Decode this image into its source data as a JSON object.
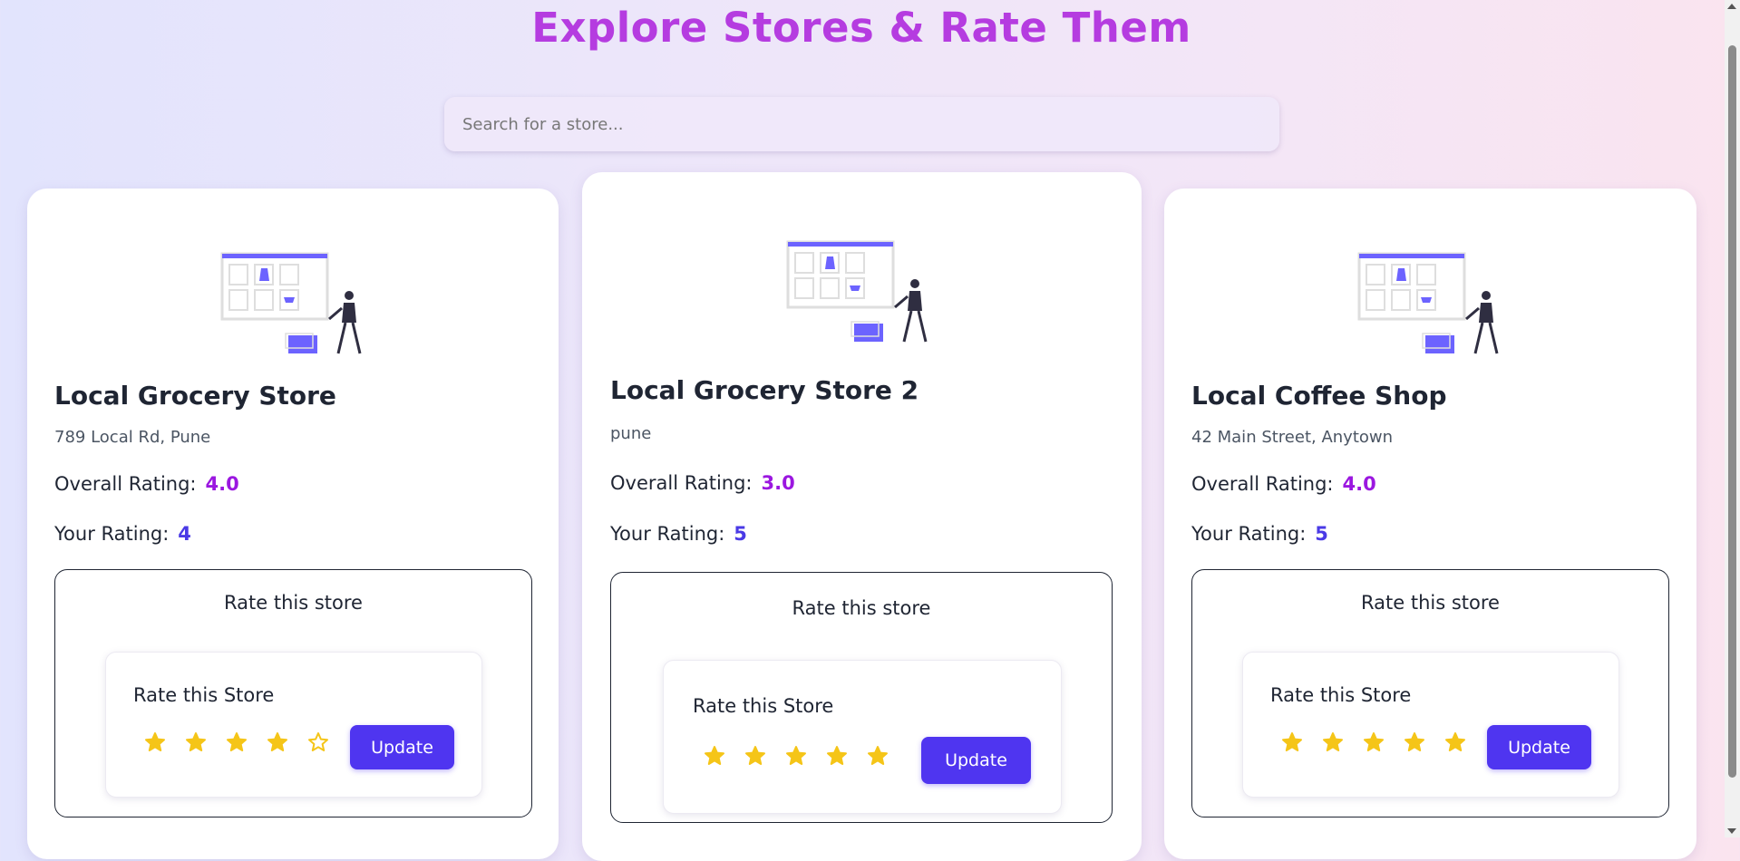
{
  "page": {
    "title": "Explore Stores & Rate Them",
    "search_placeholder": "Search for a store..."
  },
  "labels": {
    "overall": "Overall Rating:",
    "yours": "Your Rating:",
    "rate_box_title": "Rate this store",
    "inner_title": "Rate this Store",
    "update": "Update"
  },
  "stores": [
    {
      "name": "Local Grocery Store",
      "address": "789 Local Rd, Pune",
      "overall_rating": "4.0",
      "your_rating": "4",
      "stars_filled": 4
    },
    {
      "name": "Local Grocery Store 2",
      "address": "pune",
      "overall_rating": "3.0",
      "your_rating": "5",
      "stars_filled": 5
    },
    {
      "name": "Local Coffee Shop",
      "address": "42 Main Street, Anytown",
      "overall_rating": "4.0",
      "your_rating": "5",
      "stars_filled": 5
    }
  ],
  "colors": {
    "title": "#b53ce0",
    "overall_value": "#9b17e0",
    "your_value": "#4a3ae6",
    "button": "#4f35f0",
    "star": "#f5c518"
  },
  "icons": {
    "star": "star-icon",
    "illustration": "store-shopping-illustration"
  }
}
